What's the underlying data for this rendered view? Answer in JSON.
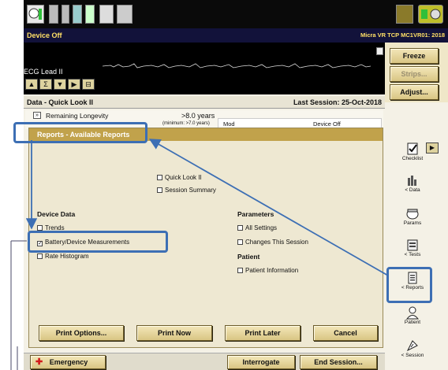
{
  "window": {
    "status": "Device Off",
    "device_model": "Micra VR TCP MC1VR01: 2018"
  },
  "ecg": {
    "lead_label": "ECG Lead II"
  },
  "right_buttons": {
    "freeze": "Freeze",
    "strips": "Strips...",
    "adjust": "Adjust..."
  },
  "quick_look": {
    "title": "Data - Quick Look II",
    "last_session": "Last Session: 25-Oct-2018",
    "remaining_longevity_label": "Remaining Longevity",
    "longevity_value": ">8.0 years",
    "longevity_minimum": "(minimum: >7.0 years)",
    "mode_label": "Mod",
    "device_status": "Device Off"
  },
  "dialog": {
    "title": "Reports - Available Reports",
    "top_options": [
      {
        "label": "Quick Look II",
        "checked": false
      },
      {
        "label": "Session Summary",
        "checked": false
      }
    ],
    "device_data": {
      "heading": "Device Data",
      "items": [
        {
          "label": "Trends",
          "checked": false
        },
        {
          "label": "Battery/Device Measurements",
          "checked": true
        },
        {
          "label": "Rate Histogram",
          "checked": false
        }
      ]
    },
    "parameters": {
      "heading": "Parameters",
      "items": [
        {
          "label": "All Settings",
          "checked": false
        },
        {
          "label": "Changes This Session",
          "checked": false
        }
      ]
    },
    "patient": {
      "heading": "Patient",
      "items": [
        {
          "label": "Patient Information",
          "checked": false
        }
      ]
    },
    "buttons": {
      "print_options": "Print Options...",
      "print_now": "Print Now",
      "print_later": "Print Later",
      "cancel": "Cancel"
    }
  },
  "sidebar": {
    "checklist": "Checklist",
    "data": "< Data",
    "params": "Params",
    "tests": "< Tests",
    "reports": "< Reports",
    "patient": "Patient",
    "session": "< Session"
  },
  "bottom_bar": {
    "emergency": "Emergency",
    "interrogate": "Interrogate",
    "end_session": "End Session..."
  },
  "colors": {
    "dialog_title": "#c1a24b",
    "button_face": "#e6d59c",
    "highlight_blue": "#3d6fb4",
    "title_bar_text": "#ffe066"
  }
}
